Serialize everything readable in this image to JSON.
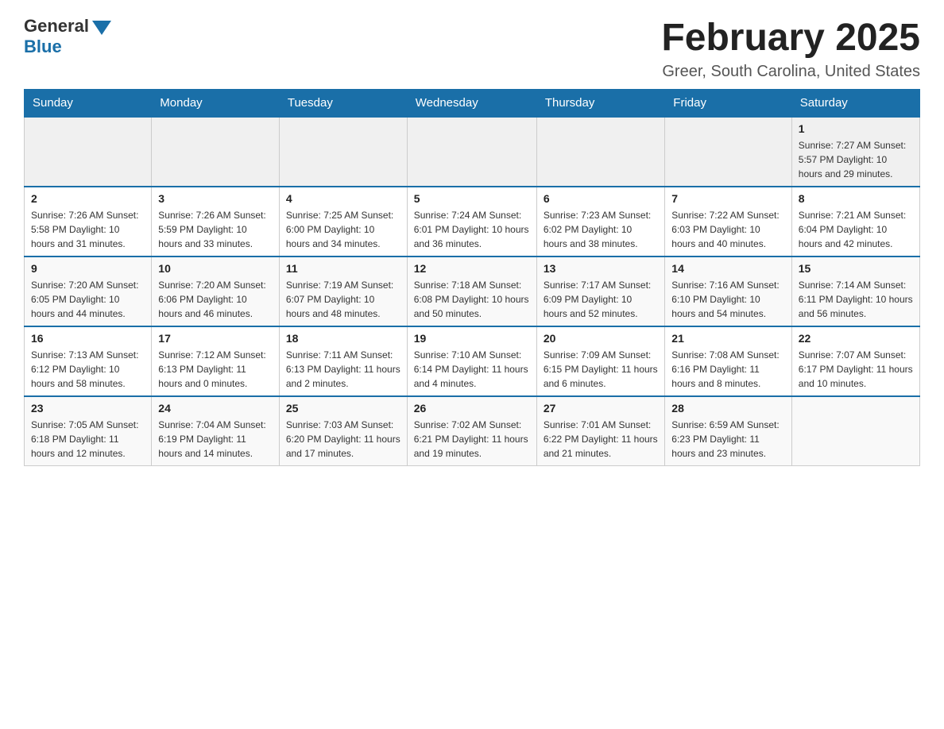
{
  "header": {
    "logo_general": "General",
    "logo_blue": "Blue",
    "month_title": "February 2025",
    "location": "Greer, South Carolina, United States"
  },
  "calendar": {
    "days_of_week": [
      "Sunday",
      "Monday",
      "Tuesday",
      "Wednesday",
      "Thursday",
      "Friday",
      "Saturday"
    ],
    "weeks": [
      [
        {
          "day": "",
          "info": ""
        },
        {
          "day": "",
          "info": ""
        },
        {
          "day": "",
          "info": ""
        },
        {
          "day": "",
          "info": ""
        },
        {
          "day": "",
          "info": ""
        },
        {
          "day": "",
          "info": ""
        },
        {
          "day": "1",
          "info": "Sunrise: 7:27 AM\nSunset: 5:57 PM\nDaylight: 10 hours and 29 minutes."
        }
      ],
      [
        {
          "day": "2",
          "info": "Sunrise: 7:26 AM\nSunset: 5:58 PM\nDaylight: 10 hours and 31 minutes."
        },
        {
          "day": "3",
          "info": "Sunrise: 7:26 AM\nSunset: 5:59 PM\nDaylight: 10 hours and 33 minutes."
        },
        {
          "day": "4",
          "info": "Sunrise: 7:25 AM\nSunset: 6:00 PM\nDaylight: 10 hours and 34 minutes."
        },
        {
          "day": "5",
          "info": "Sunrise: 7:24 AM\nSunset: 6:01 PM\nDaylight: 10 hours and 36 minutes."
        },
        {
          "day": "6",
          "info": "Sunrise: 7:23 AM\nSunset: 6:02 PM\nDaylight: 10 hours and 38 minutes."
        },
        {
          "day": "7",
          "info": "Sunrise: 7:22 AM\nSunset: 6:03 PM\nDaylight: 10 hours and 40 minutes."
        },
        {
          "day": "8",
          "info": "Sunrise: 7:21 AM\nSunset: 6:04 PM\nDaylight: 10 hours and 42 minutes."
        }
      ],
      [
        {
          "day": "9",
          "info": "Sunrise: 7:20 AM\nSunset: 6:05 PM\nDaylight: 10 hours and 44 minutes."
        },
        {
          "day": "10",
          "info": "Sunrise: 7:20 AM\nSunset: 6:06 PM\nDaylight: 10 hours and 46 minutes."
        },
        {
          "day": "11",
          "info": "Sunrise: 7:19 AM\nSunset: 6:07 PM\nDaylight: 10 hours and 48 minutes."
        },
        {
          "day": "12",
          "info": "Sunrise: 7:18 AM\nSunset: 6:08 PM\nDaylight: 10 hours and 50 minutes."
        },
        {
          "day": "13",
          "info": "Sunrise: 7:17 AM\nSunset: 6:09 PM\nDaylight: 10 hours and 52 minutes."
        },
        {
          "day": "14",
          "info": "Sunrise: 7:16 AM\nSunset: 6:10 PM\nDaylight: 10 hours and 54 minutes."
        },
        {
          "day": "15",
          "info": "Sunrise: 7:14 AM\nSunset: 6:11 PM\nDaylight: 10 hours and 56 minutes."
        }
      ],
      [
        {
          "day": "16",
          "info": "Sunrise: 7:13 AM\nSunset: 6:12 PM\nDaylight: 10 hours and 58 minutes."
        },
        {
          "day": "17",
          "info": "Sunrise: 7:12 AM\nSunset: 6:13 PM\nDaylight: 11 hours and 0 minutes."
        },
        {
          "day": "18",
          "info": "Sunrise: 7:11 AM\nSunset: 6:13 PM\nDaylight: 11 hours and 2 minutes."
        },
        {
          "day": "19",
          "info": "Sunrise: 7:10 AM\nSunset: 6:14 PM\nDaylight: 11 hours and 4 minutes."
        },
        {
          "day": "20",
          "info": "Sunrise: 7:09 AM\nSunset: 6:15 PM\nDaylight: 11 hours and 6 minutes."
        },
        {
          "day": "21",
          "info": "Sunrise: 7:08 AM\nSunset: 6:16 PM\nDaylight: 11 hours and 8 minutes."
        },
        {
          "day": "22",
          "info": "Sunrise: 7:07 AM\nSunset: 6:17 PM\nDaylight: 11 hours and 10 minutes."
        }
      ],
      [
        {
          "day": "23",
          "info": "Sunrise: 7:05 AM\nSunset: 6:18 PM\nDaylight: 11 hours and 12 minutes."
        },
        {
          "day": "24",
          "info": "Sunrise: 7:04 AM\nSunset: 6:19 PM\nDaylight: 11 hours and 14 minutes."
        },
        {
          "day": "25",
          "info": "Sunrise: 7:03 AM\nSunset: 6:20 PM\nDaylight: 11 hours and 17 minutes."
        },
        {
          "day": "26",
          "info": "Sunrise: 7:02 AM\nSunset: 6:21 PM\nDaylight: 11 hours and 19 minutes."
        },
        {
          "day": "27",
          "info": "Sunrise: 7:01 AM\nSunset: 6:22 PM\nDaylight: 11 hours and 21 minutes."
        },
        {
          "day": "28",
          "info": "Sunrise: 6:59 AM\nSunset: 6:23 PM\nDaylight: 11 hours and 23 minutes."
        },
        {
          "day": "",
          "info": ""
        }
      ]
    ]
  }
}
